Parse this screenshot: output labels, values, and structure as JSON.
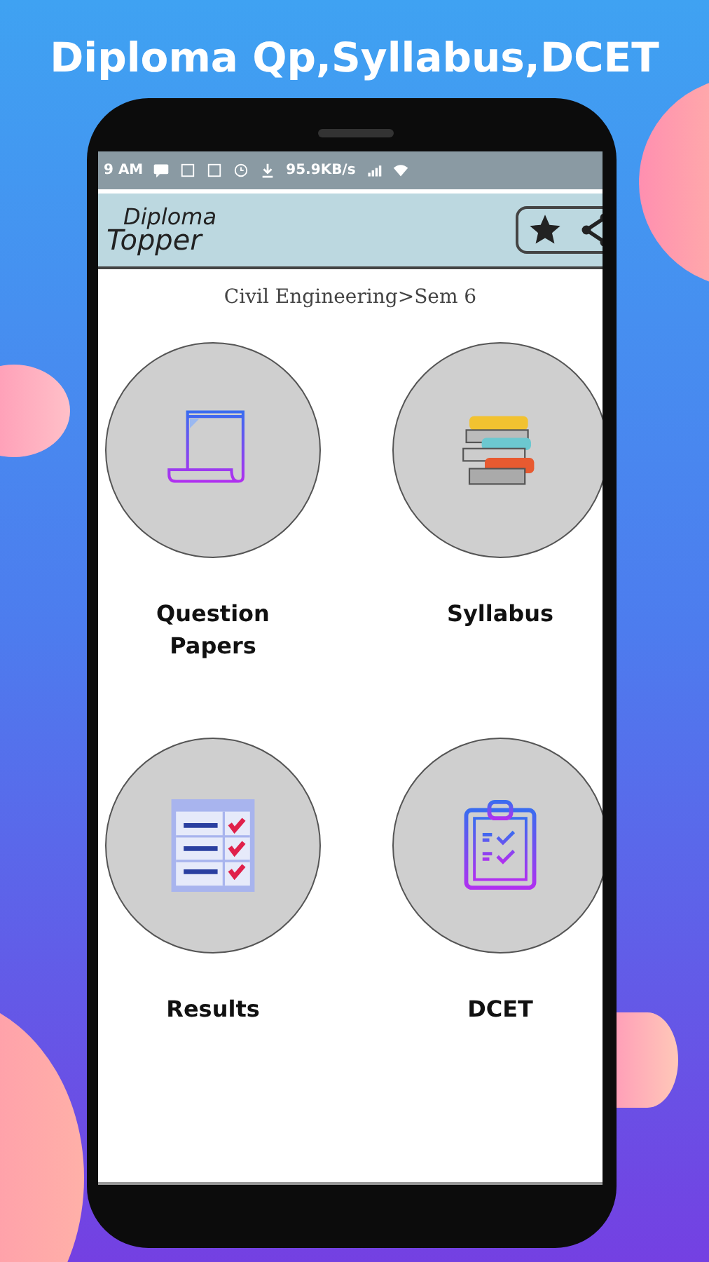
{
  "headline": "Diploma Qp,Syllabus,DCET",
  "status_bar": {
    "time": "9 AM",
    "speed": "95.9KB/s"
  },
  "app_bar": {
    "logo_top": "Diploma",
    "logo_bottom": "Topper"
  },
  "breadcrumb": "Civil Engineering>Sem 6",
  "tiles": [
    {
      "label": "Question Papers",
      "kind": "papers"
    },
    {
      "label": "Syllabus",
      "kind": "books"
    },
    {
      "label": "Results",
      "kind": "results"
    },
    {
      "label": "DCET",
      "kind": "clipboard"
    }
  ]
}
